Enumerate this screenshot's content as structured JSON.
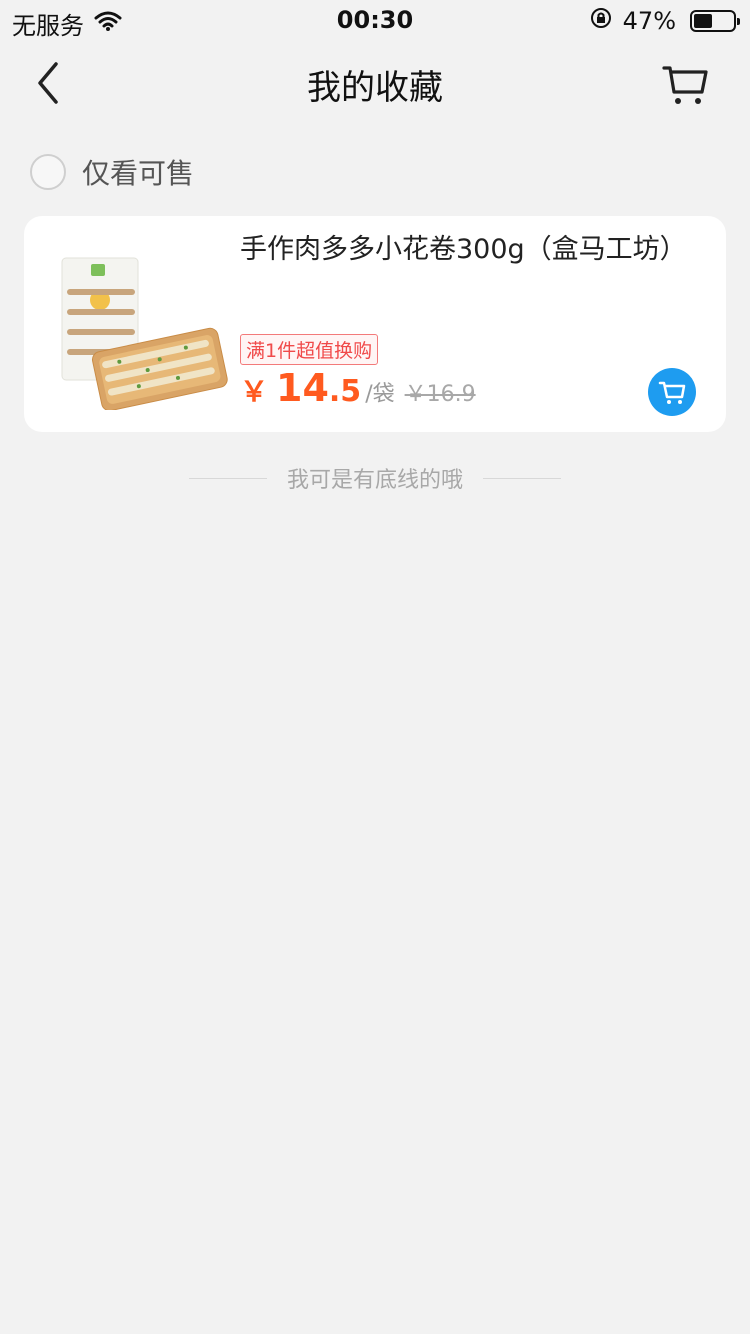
{
  "status_bar": {
    "carrier": "无服务",
    "time": "00:30",
    "battery_text": "47%",
    "battery_level": 0.47,
    "icons": [
      "wifi-icon",
      "rotation-lock-icon",
      "battery-icon"
    ]
  },
  "nav": {
    "title": "我的收藏",
    "icons": [
      "back-chevron-icon",
      "cart-icon"
    ]
  },
  "filter": {
    "label": "仅看可售",
    "checked": false
  },
  "products": [
    {
      "title": "手作肉多多小花卷300g（盒马工坊）",
      "promo": "满1件超值换购",
      "currency": "￥",
      "price_int": "14",
      "price_dec": ".5",
      "unit": "/袋",
      "original_price": "￥16.9",
      "icon": "add-to-cart-icon"
    }
  ],
  "footer": {
    "text": "我可是有底线的哦"
  },
  "colors": {
    "background": "#f2f2f2",
    "price": "#ff5a1f",
    "promo": "#f04a4a",
    "cart_button": "#1e9cf0"
  }
}
